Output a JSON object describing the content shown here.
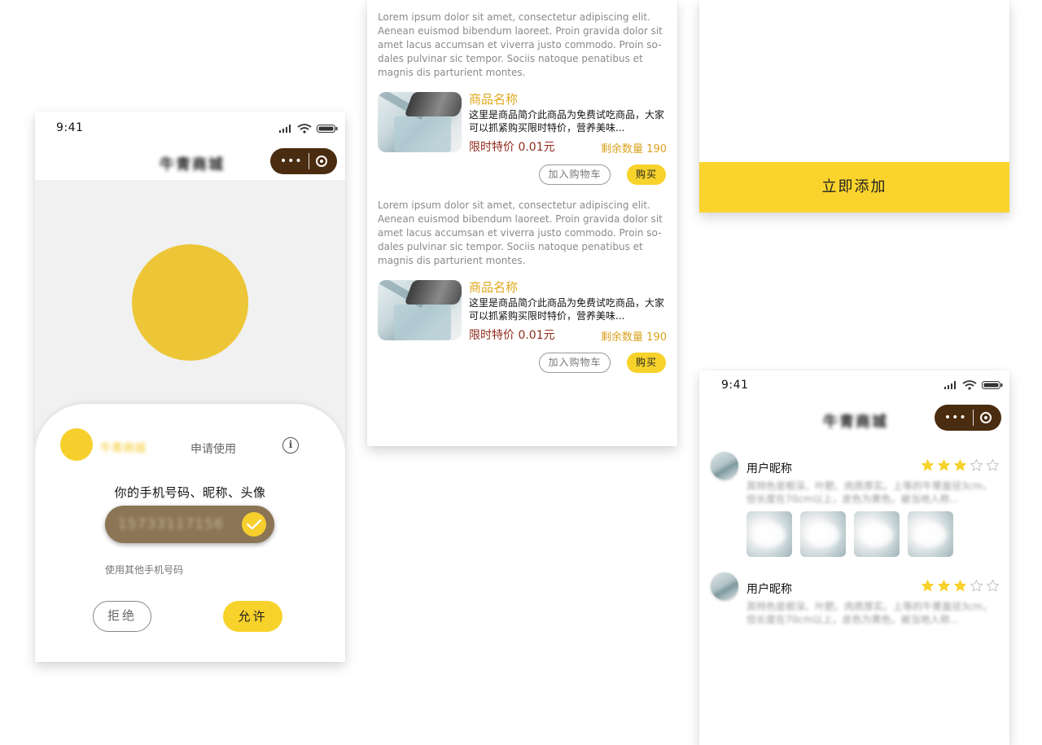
{
  "phone1": {
    "status": {
      "time": "9:41"
    },
    "nav": {
      "title": "牛青商城"
    },
    "sheet": {
      "app_name": "牛青商城",
      "request": "申请使用",
      "question": "你的手机号码、昵称、头像",
      "phone_number": "15733117156",
      "other_phone": "使用其他手机号码",
      "reject": "拒绝",
      "allow": "允许"
    }
  },
  "product_list": {
    "items": [
      {
        "lorem": "Lorem ipsum dolor sit amet, consectetur adipiscing elit. Aenean euismod bibendum laoreet. Proin gravida dolor sit amet lacus accumsan et viverra justo commodo. Proin so-dales pulvinar sic tempor. Sociis natoque penatibus et magnis dis parturient montes.",
        "name": "商品名称",
        "desc": "这里是商品简介此商品为免费试吃商品，大家可以抓紧购买限时特价，营养美味...",
        "price": "限时特价 0.01元",
        "stock": "剩余数量 190",
        "cart": "加入购物车",
        "buy": "购买"
      },
      {
        "lorem": "Lorem ipsum dolor sit amet, consectetur adipiscing elit. Aenean euismod bibendum laoreet. Proin gravida dolor sit amet lacus accumsan et viverra justo commodo. Proin so-dales pulvinar sic tempor. Sociis natoque penatibus et magnis dis parturient montes.",
        "name": "商品名称",
        "desc": "这里是商品简介此商品为免费试吃商品，大家可以抓紧购买限时特价，营养美味...",
        "price": "限时特价 0.01元",
        "stock": "剩余数量 190",
        "cart": "加入购物车",
        "buy": "购买"
      }
    ]
  },
  "add_panel": {
    "button": "立即添加"
  },
  "reviews": {
    "status": {
      "time": "9:41"
    },
    "nav": {
      "title": "牛青商城"
    },
    "items": [
      {
        "user": "用户昵称",
        "rating": 3,
        "max_rating": 5,
        "text": "其特色是根深、叶肥、肉质厚实。上等的牛蒡直径3cm，但长度在70cm以上，皮色为黄色，被当地人称..."
      },
      {
        "user": "用户昵称",
        "rating": 3,
        "max_rating": 5,
        "text": "其特色是根深、叶肥、肉质厚实。上等的牛蒡直径3cm，但长度在70cm以上，皮色为黄色，被当地人称..."
      }
    ]
  },
  "colors": {
    "accent_yellow": "#f7d22b",
    "capsule_brown": "#4a2c10",
    "price_red": "#8f2a1b",
    "name_gold": "#e0a81c",
    "phone_pill": "#8b7555"
  }
}
